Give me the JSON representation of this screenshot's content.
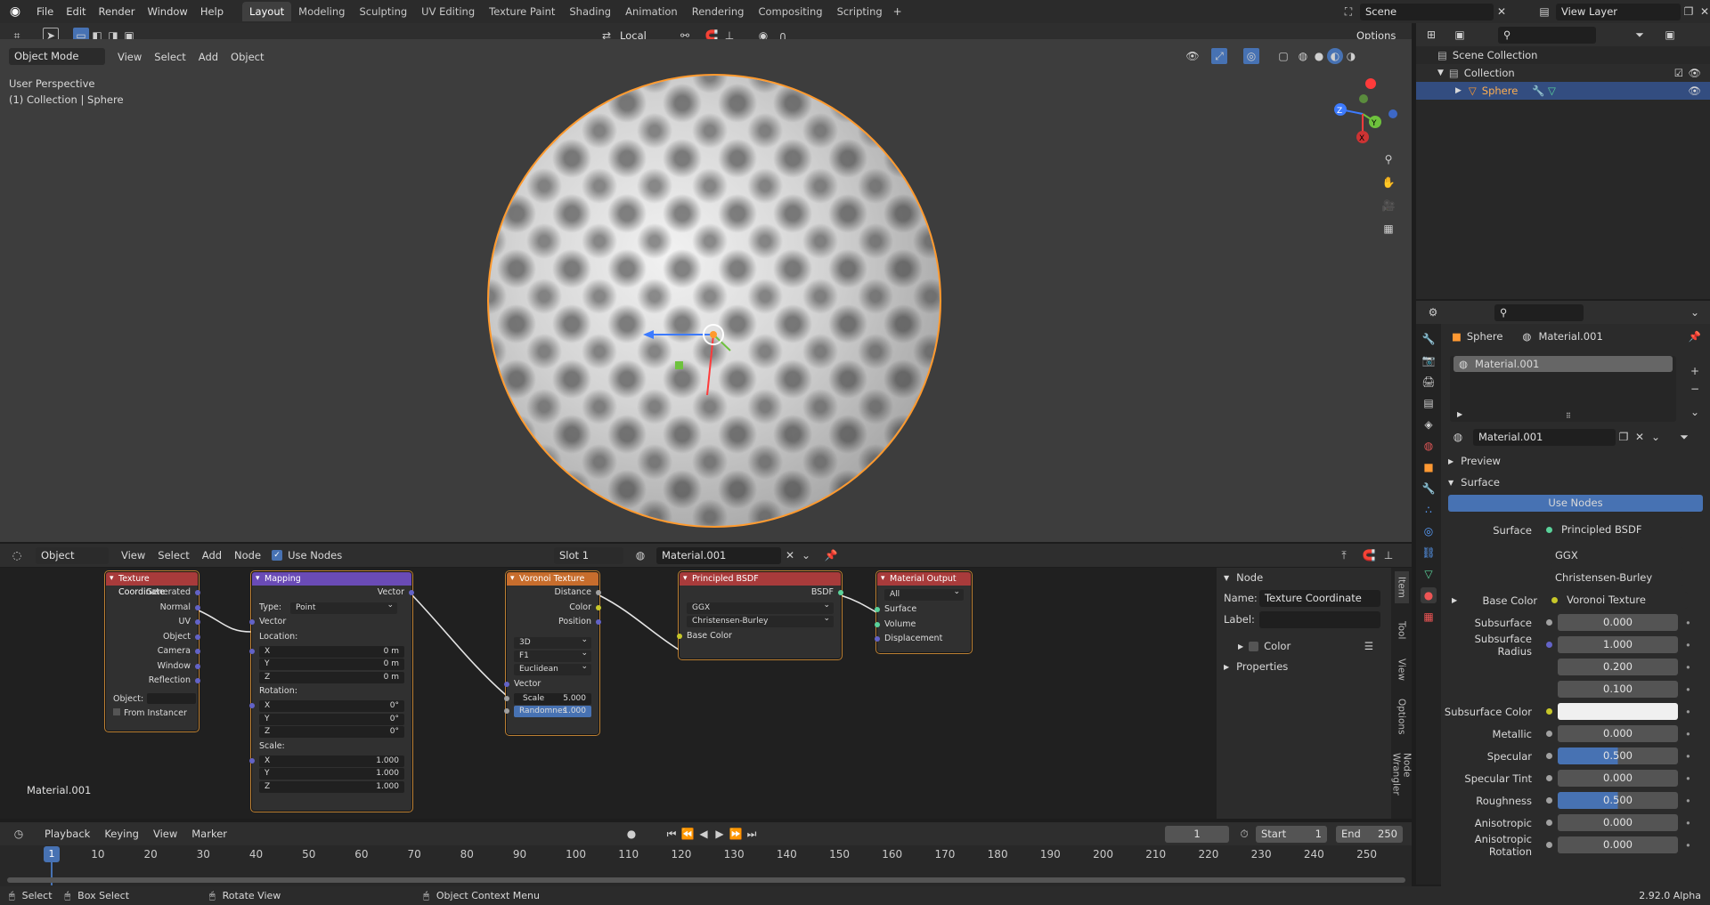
{
  "topbar": {
    "menus": [
      "File",
      "Edit",
      "Render",
      "Window",
      "Help"
    ],
    "workspaces": [
      "Layout",
      "Modeling",
      "Sculpting",
      "UV Editing",
      "Texture Paint",
      "Shading",
      "Animation",
      "Rendering",
      "Compositing",
      "Scripting"
    ],
    "active_workspace": "Layout",
    "scene": "Scene",
    "view_layer": "View Layer"
  },
  "viewport_header": {
    "mode": "Object Mode",
    "menus": [
      "View",
      "Select",
      "Add",
      "Object"
    ],
    "orientation": "Local",
    "options": "Options"
  },
  "viewport": {
    "perspective": "User Perspective",
    "collection_info": "(1) Collection | Sphere"
  },
  "outliner": {
    "scene_collection": "Scene Collection",
    "collection": "Collection",
    "object": "Sphere"
  },
  "node_editor_header": {
    "type": "Object",
    "menus": [
      "View",
      "Select",
      "Add",
      "Node"
    ],
    "use_nodes": "Use Nodes",
    "slot": "Slot 1",
    "material": "Material.001"
  },
  "nodes": {
    "tex_coord": {
      "title": "Texture Coordinate",
      "outputs": [
        "Generated",
        "Normal",
        "UV",
        "Object",
        "Camera",
        "Window",
        "Reflection"
      ],
      "object_label": "Object:",
      "from_instancer": "From Instancer"
    },
    "mapping": {
      "title": "Mapping",
      "output": "Vector",
      "type_label": "Type:",
      "type_value": "Point",
      "vector": "Vector",
      "location": "Location:",
      "loc": [
        [
          "X",
          "0 m"
        ],
        [
          "Y",
          "0 m"
        ],
        [
          "Z",
          "0 m"
        ]
      ],
      "rotation": "Rotation:",
      "rot": [
        [
          "X",
          "0°"
        ],
        [
          "Y",
          "0°"
        ],
        [
          "Z",
          "0°"
        ]
      ],
      "scale": "Scale:",
      "scl": [
        [
          "X",
          "1.000"
        ],
        [
          "Y",
          "1.000"
        ],
        [
          "Z",
          "1.000"
        ]
      ]
    },
    "voronoi": {
      "title": "Voronoi Texture",
      "outputs": [
        "Distance",
        "Color",
        "Position"
      ],
      "dims": "3D",
      "feature": "F1",
      "metric": "Euclidean",
      "vector": "Vector",
      "scale_label": "Scale",
      "scale_value": "5.000",
      "rand_label": "Randomnes",
      "rand_value": "1.000"
    },
    "bsdf": {
      "title": "Principled BSDF",
      "output": "BSDF",
      "dist": "GGX",
      "sss": "Christensen-Burley",
      "input": "Base Color"
    },
    "output": {
      "title": "Material Output",
      "target": "All",
      "inputs": [
        "Surface",
        "Volume",
        "Displacement"
      ]
    }
  },
  "node_editor_label": "Material.001",
  "node_sidebar": {
    "section": "Node",
    "name_label": "Name:",
    "name_value": "Texture Coordinate",
    "label_label": "Label:",
    "color": "Color",
    "properties": "Properties",
    "tabs": [
      "Item",
      "Tool",
      "View",
      "Options",
      "Node Wrangler"
    ]
  },
  "properties": {
    "object": "Sphere",
    "material": "Material.001",
    "slot_item": "Material.001",
    "datablock": "Material.001",
    "preview": "Preview",
    "surface": "Surface",
    "use_nodes": "Use Nodes",
    "surface_label": "Surface",
    "surface_value": "Principled BSDF",
    "dist": "GGX",
    "sss_method": "Christensen-Burley",
    "base_color_label": "Base Color",
    "base_color_value": "Voronoi Texture",
    "rows": [
      {
        "label": "Subsurface",
        "value": "0.000"
      },
      {
        "label": "Subsurface Radius",
        "value": "1.000"
      },
      {
        "label": "",
        "value": "0.200"
      },
      {
        "label": "",
        "value": "0.100"
      },
      {
        "label": "Subsurface Color",
        "value": ""
      },
      {
        "label": "Metallic",
        "value": "0.000"
      },
      {
        "label": "Specular",
        "value": "0.500",
        "fill": 0.5
      },
      {
        "label": "Specular Tint",
        "value": "0.000"
      },
      {
        "label": "Roughness",
        "value": "0.500",
        "fill": 0.5
      },
      {
        "label": "Anisotropic",
        "value": "0.000"
      },
      {
        "label": "Anisotropic Rotation",
        "value": "0.000"
      }
    ]
  },
  "timeline": {
    "menus": [
      "Playback",
      "Keying",
      "View",
      "Marker"
    ],
    "current_frame": "1",
    "start_label": "Start",
    "start": "1",
    "end_label": "End",
    "end": "250",
    "ticks": [
      "1",
      "10",
      "20",
      "30",
      "40",
      "50",
      "60",
      "70",
      "80",
      "90",
      "100",
      "110",
      "120",
      "130",
      "140",
      "150",
      "160",
      "170",
      "180",
      "190",
      "200",
      "210",
      "220",
      "230",
      "240",
      "250"
    ]
  },
  "statusbar": {
    "select": "Select",
    "box_select": "Box Select",
    "rotate": "Rotate View",
    "context": "Object Context Menu",
    "version": "2.92.0 Alpha"
  }
}
